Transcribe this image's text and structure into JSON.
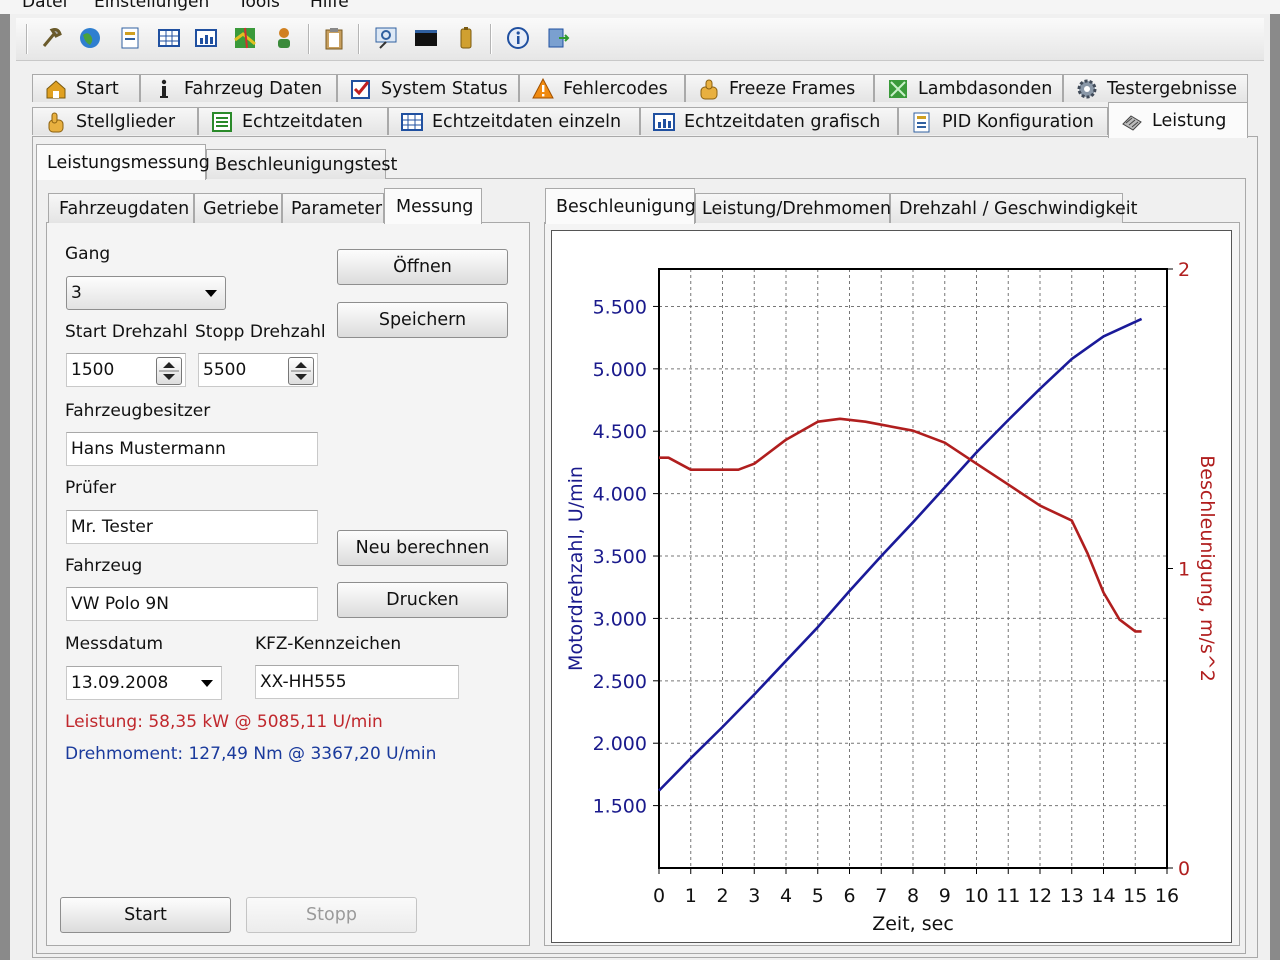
{
  "menu": [
    "Datei",
    "Einstellungen",
    "Tools",
    "Hilfe"
  ],
  "toolbar_icons": [
    "wrench-icon",
    "globe-icon",
    "document-icon",
    "table-icon",
    "bar-chart-icon",
    "map-icon",
    "person-icon",
    "clipboard-icon",
    "search-screen-icon",
    "terminal-icon",
    "battery-icon",
    "info-icon",
    "exit-icon"
  ],
  "main_tabs_row1": [
    {
      "label": "Start",
      "icon": "home-icon"
    },
    {
      "label": "Fahrzeug Daten",
      "icon": "info-icon"
    },
    {
      "label": "System Status",
      "icon": "checkbox-icon"
    },
    {
      "label": "Fehlercodes",
      "icon": "warning-icon"
    },
    {
      "label": "Freeze Frames",
      "icon": "thumb-icon"
    },
    {
      "label": "Lambdasonden",
      "icon": "sensor-icon"
    },
    {
      "label": "Testergebnisse",
      "icon": "gear-icon"
    }
  ],
  "main_tabs_row2": [
    {
      "label": "Stellglieder",
      "icon": "hand-icon"
    },
    {
      "label": "Echtzeitdaten",
      "icon": "list-icon"
    },
    {
      "label": "Echtzeitdaten einzeln",
      "icon": "grid-icon"
    },
    {
      "label": "Echtzeitdaten grafisch",
      "icon": "chart-icon"
    },
    {
      "label": "PID Konfiguration",
      "icon": "config-icon"
    },
    {
      "label": "Leistung",
      "icon": "dyno-icon",
      "active": true
    }
  ],
  "sub_tabs": [
    "Leistungsmessung",
    "Beschleunigungstest"
  ],
  "left_tabs": [
    "Fahrzeugdaten",
    "Getriebe",
    "Parameter",
    "Messung"
  ],
  "form": {
    "gang_label": "Gang",
    "gang_value": "3",
    "start_label": "Start Drehzahl",
    "stop_label": "Stopp Drehzahl",
    "start_value": "1500",
    "stop_value": "5500",
    "owner_label": "Fahrzeugbesitzer",
    "owner_value": "Hans Mustermann",
    "tester_label": "Prüfer",
    "tester_value": "Mr. Tester",
    "vehicle_label": "Fahrzeug",
    "vehicle_value": "VW Polo 9N",
    "date_label": "Messdatum",
    "date_value": "13.09.2008",
    "plate_label": "KFZ-Kennzeichen",
    "plate_value": "XX-HH555"
  },
  "buttons": {
    "open": "Öffnen",
    "save": "Speichern",
    "recalc": "Neu berechnen",
    "print": "Drucken",
    "start": "Start",
    "stop": "Stopp"
  },
  "results": {
    "power": "Leistung: 58,35 kW @ 5085,11 U/min",
    "torque": "Drehmoment: 127,49 Nm @ 3367,20 U/min",
    "power_color": "#c0282d",
    "torque_color": "#1a3a9c"
  },
  "chart_tabs": [
    "Beschleunigung",
    "Leistung/Drehmoment",
    "Drehzahl / Geschwindigkeit"
  ],
  "chart_data": {
    "type": "line",
    "xlabel": "Zeit, sec",
    "ylabel": "Motordrehzahl, U/min",
    "y2label": "Beschleunigung, m/s^2",
    "xlim": [
      0,
      16
    ],
    "ylim": [
      1000,
      5800
    ],
    "y2lim": [
      0,
      2
    ],
    "x_ticks": [
      0,
      1,
      2,
      3,
      4,
      5,
      6,
      7,
      8,
      9,
      10,
      11,
      12,
      13,
      14,
      15,
      16
    ],
    "y_ticks": [
      1500,
      2000,
      2500,
      3000,
      3500,
      4000,
      4500,
      5000,
      5500
    ],
    "y_tick_labels": [
      "1.500",
      "2.000",
      "2.500",
      "3.000",
      "3.500",
      "4.000",
      "4.500",
      "5.000",
      "5.500"
    ],
    "y2_ticks": [
      0,
      1,
      2
    ],
    "grid": true,
    "series": [
      {
        "axis": "left",
        "color": "#1a1a99",
        "x": [
          0,
          1,
          2,
          3,
          4,
          5,
          6,
          7,
          8,
          9,
          10,
          11,
          12,
          13,
          14,
          15.2
        ],
        "y": [
          1620,
          1880,
          2130,
          2390,
          2660,
          2930,
          3220,
          3500,
          3770,
          4050,
          4330,
          4590,
          4840,
          5080,
          5260,
          5400
        ]
      },
      {
        "axis": "right",
        "color": "#b01e1e",
        "x": [
          0,
          0.3,
          1,
          2,
          2.5,
          3,
          4,
          5,
          5.7,
          6.5,
          7,
          8,
          9,
          10,
          11,
          12,
          13,
          13.5,
          14,
          14.5,
          15,
          15.2
        ],
        "y": [
          1.37,
          1.37,
          1.33,
          1.33,
          1.33,
          1.35,
          1.43,
          1.49,
          1.5,
          1.49,
          1.48,
          1.46,
          1.42,
          1.35,
          1.28,
          1.21,
          1.16,
          1.05,
          0.92,
          0.83,
          0.79,
          0.79
        ]
      }
    ]
  }
}
